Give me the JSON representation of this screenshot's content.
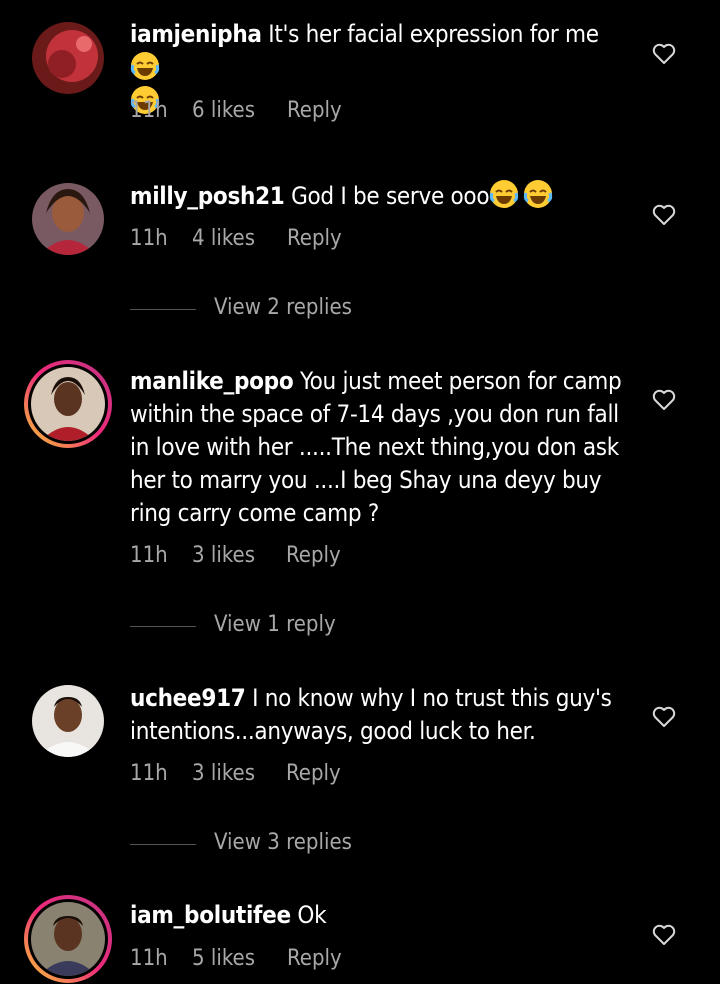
{
  "comments": [
    {
      "username": "iamjenipha",
      "text": "It's her facial expression for me",
      "time": "11h",
      "likes": "6 likes",
      "reply_label": "Reply",
      "story_ring": false
    },
    {
      "username": "milly_posh21",
      "text": "God I be serve ooo",
      "time": "11h",
      "likes": "4 likes",
      "reply_label": "Reply",
      "view_replies": "View 2 replies",
      "story_ring": false
    },
    {
      "username": "manlike_popo",
      "text": "You just meet person for camp within the space of 7-14 days ,you don run fall in love with her .....The next thing,you don ask her to marry you ....I beg Shay una deyy buy ring carry come camp ?",
      "time": "11h",
      "likes": "3 likes",
      "reply_label": "Reply",
      "view_replies": "View 1 reply",
      "story_ring": true
    },
    {
      "username": "uchee917",
      "text": "I no know why I no trust this guy's intentions...anyways, good luck to her.",
      "time": "11h",
      "likes": "3 likes",
      "reply_label": "Reply",
      "view_replies": "View 3 replies",
      "story_ring": false
    },
    {
      "username": "iam_bolutifee",
      "text": "Ok",
      "time": "11h",
      "likes": "5 likes",
      "reply_label": "Reply",
      "story_ring": true
    }
  ],
  "colors": {
    "background": "#000000",
    "text": "#ffffff",
    "muted": "#a8a8a8",
    "story_ring": [
      "#f9ce34",
      "#ee2a7b",
      "#c13584"
    ]
  },
  "icons": {
    "like": "heart-outline-icon",
    "emoji": "face-with-tears-of-joy-emoji"
  }
}
